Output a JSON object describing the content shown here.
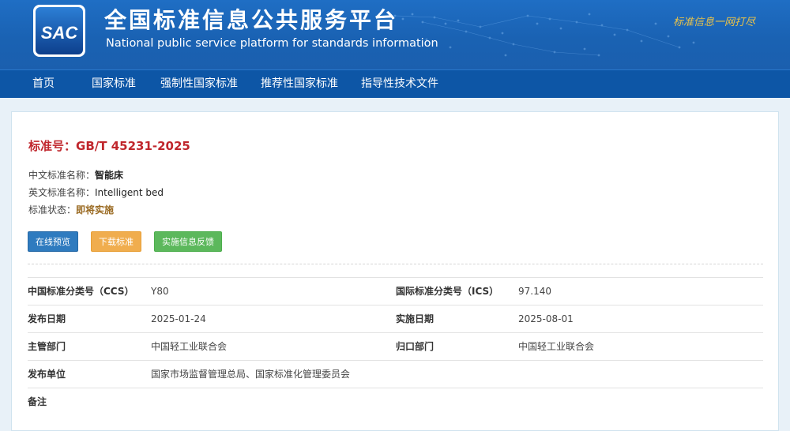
{
  "header": {
    "title_cn": "全国标准信息公共服务平台",
    "title_en": "National public service platform  for standards information",
    "logo_text": "SAC",
    "slogan": "标准信息一网打尽"
  },
  "nav": {
    "items": [
      "首页",
      "国家标准",
      "强制性国家标准",
      "推荐性国家标准",
      "指导性技术文件"
    ]
  },
  "standard": {
    "number_label": "标准号：",
    "number": "GB/T 45231-2025",
    "cn_name_label": "中文标准名称：",
    "cn_name": "智能床",
    "en_name_label": "英文标准名称：",
    "en_name": "Intelligent bed",
    "status_label": "标准状态：",
    "status": "即将实施"
  },
  "actions": {
    "preview": "在线预览",
    "download": "下载标准",
    "feedback": "实施信息反馈"
  },
  "details": {
    "ccs_label": "中国标准分类号（CCS）",
    "ccs": "Y80",
    "ics_label": "国际标准分类号（ICS）",
    "ics": "97.140",
    "publish_date_label": "发布日期",
    "publish_date": "2025-01-24",
    "implement_date_label": "实施日期",
    "implement_date": "2025-08-01",
    "authority_label": "主管部门",
    "authority": "中国轻工业联合会",
    "centralized_label": "归口部门",
    "centralized": "中国轻工业联合会",
    "issuer_label": "发布单位",
    "issuer": "国家市场监督管理总局、国家标准化管理委员会",
    "remark_label": "备注",
    "remark": ""
  },
  "colors": {
    "banner": "#1f6ec4",
    "nav": "#0d56a6",
    "standard_number": "#c0272d",
    "status": "#9a6a22",
    "btn_preview": "#2f7bbf",
    "btn_download": "#f0ad4e",
    "btn_feedback": "#5cb85c"
  }
}
